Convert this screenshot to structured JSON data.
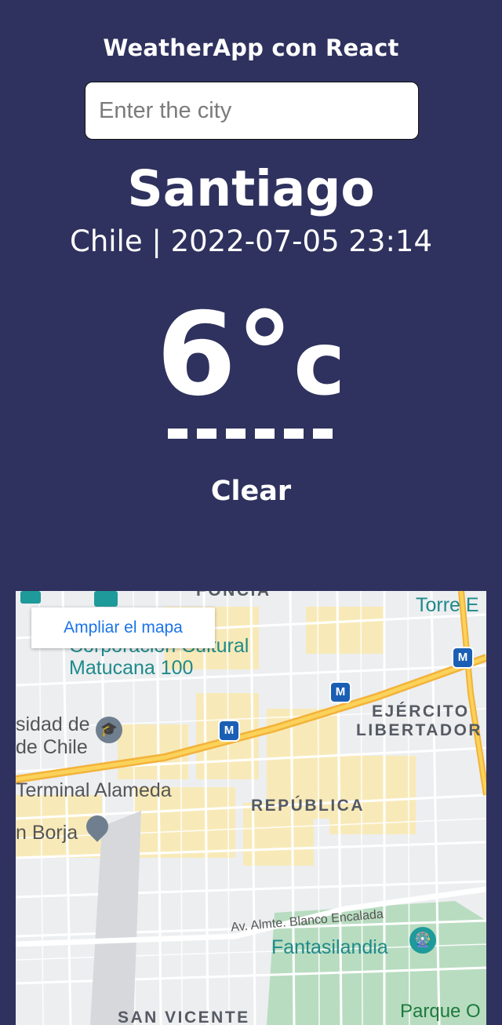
{
  "app": {
    "title": "WeatherApp con React"
  },
  "search": {
    "placeholder": "Enter the city"
  },
  "weather": {
    "city": "Santiago",
    "meta": "Chile | 2022-07-05 23:14",
    "temp_value": "6°",
    "temp_unit": "c",
    "condition": "Clear"
  },
  "map": {
    "expand_label": "Ampliar el mapa",
    "labels": {
      "torre": "Torre E",
      "corporacion": "Corporación Cultural",
      "matucana": "Matucana 100",
      "universidad_1": "sidad de",
      "universidad_2": "de Chile",
      "ejercito_1": "EJÉRCITO",
      "ejercito_2": "LIBERTADOR",
      "terminal": "Terminal Alameda",
      "republica": "REPÚBLICA",
      "borja": "n Borja",
      "avenida": "Av. Almte. Blanco Encalada",
      "fantasilandia": "Fantasilandia",
      "parque": "Parque O",
      "san_vicente": "SAN VICENTE",
      "top_cut": "FONCIA"
    },
    "metro_symbol": "M",
    "icons": [
      "graduation-cap-icon",
      "map-pin-icon",
      "amusement-park-icon",
      "metro-icon"
    ]
  }
}
